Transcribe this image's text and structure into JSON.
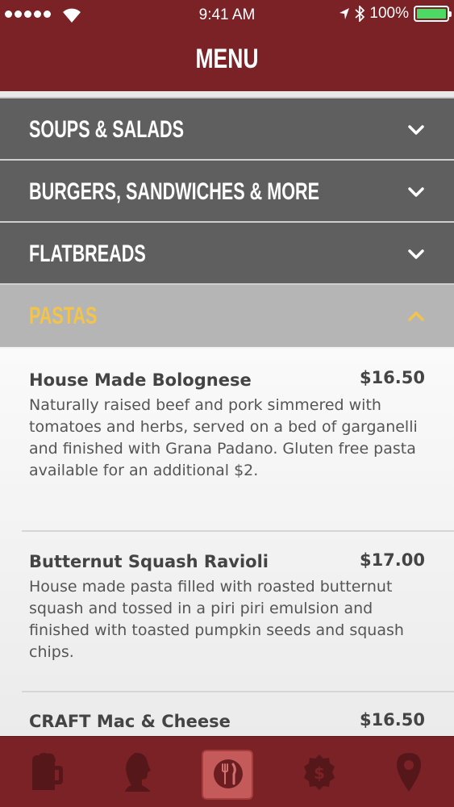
{
  "status_bar": {
    "time": "9:41 AM",
    "battery": "100%",
    "icons": [
      "signal-dots-icon",
      "wifi-icon",
      "location-arrow-icon",
      "bluetooth-icon",
      "battery-icon"
    ]
  },
  "nav": {
    "title": "MENU"
  },
  "categories": [
    {
      "label": "SOUPS & SALADS",
      "expanded": false
    },
    {
      "label": "BURGERS, SANDWICHES & MORE",
      "expanded": false
    },
    {
      "label": "FLATBREADS",
      "expanded": false
    },
    {
      "label": "PASTAS",
      "expanded": true
    }
  ],
  "items": [
    {
      "name": "House Made Bolognese",
      "price": "$16.50",
      "description": "Naturally raised beef and pork simmered with tomatoes and herbs, served on a bed of garganelli and finished with Grana Padano. Gluten free pasta available for an additional $2."
    },
    {
      "name": "Butternut Squash Ravioli",
      "price": "$17.00",
      "description": "House made pasta filled with roasted butternut squash and tossed in a piri piri emulsion and finished with toasted pumpkin seeds and squash chips."
    },
    {
      "name": "CRAFT Mac & Cheese",
      "price": "$16.50",
      "description": ""
    }
  ],
  "tabbar": {
    "tabs": [
      {
        "icon": "beer-mug-icon",
        "active": false
      },
      {
        "icon": "profile-head-icon",
        "active": false
      },
      {
        "icon": "fork-knife-icon",
        "active": true
      },
      {
        "icon": "dollar-badge-icon",
        "active": false
      },
      {
        "icon": "location-pin-icon",
        "active": false
      }
    ]
  },
  "colors": {
    "brand": "#7a2226",
    "category_bg": "#5f5f5f",
    "expanded_bg": "#b5b5b5",
    "expanded_text": "#f2c44c",
    "battery_fill": "#4cd964"
  }
}
